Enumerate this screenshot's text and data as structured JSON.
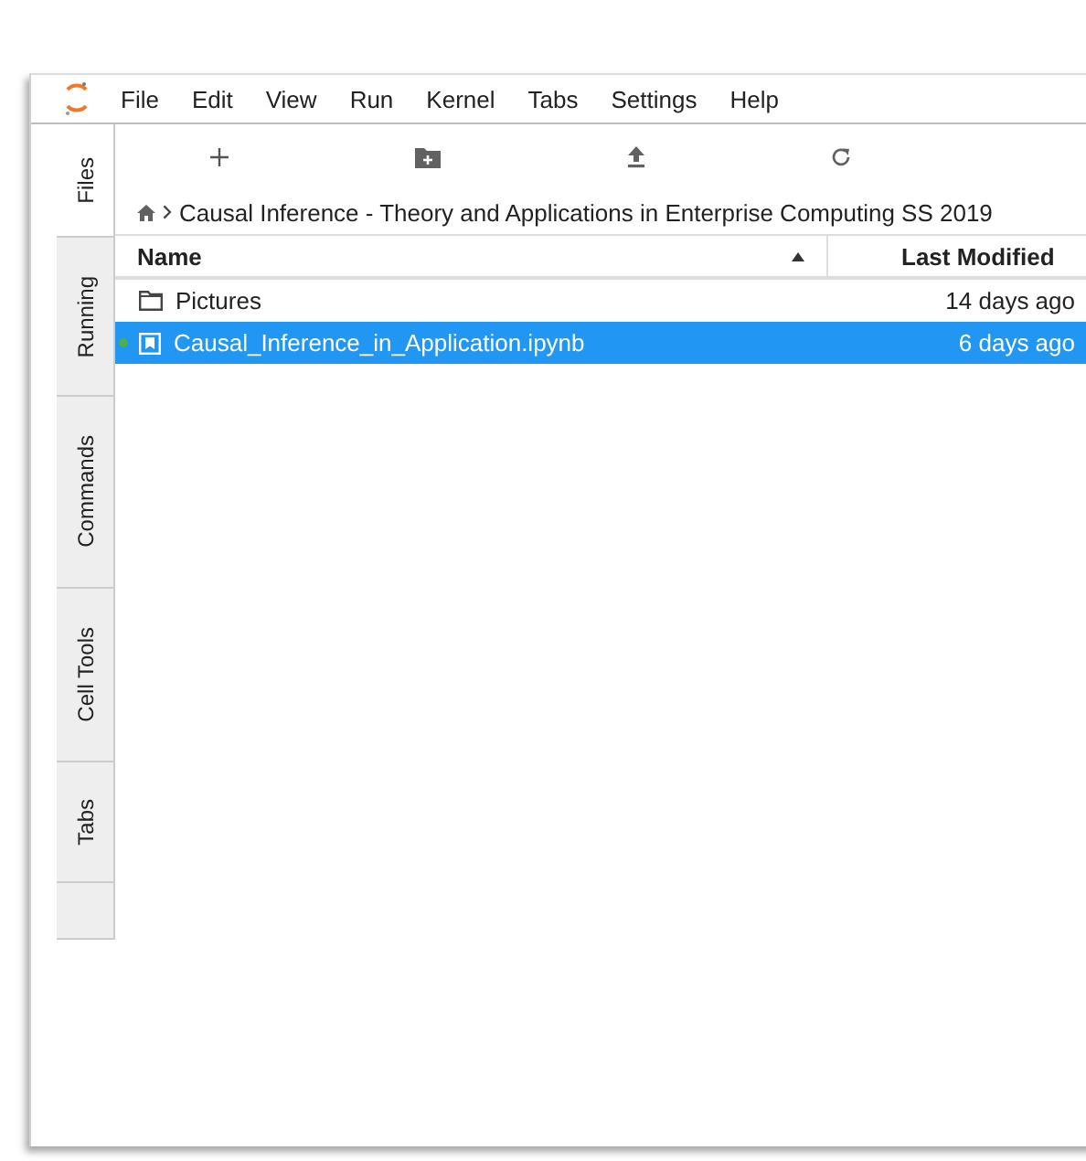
{
  "menu": [
    "File",
    "Edit",
    "View",
    "Run",
    "Kernel",
    "Tabs",
    "Settings",
    "Help"
  ],
  "side_tabs": [
    {
      "label": "Files",
      "selected": true
    },
    {
      "label": "Running",
      "selected": false
    },
    {
      "label": "Commands",
      "selected": false
    },
    {
      "label": "Cell Tools",
      "selected": false
    },
    {
      "label": "Tabs",
      "selected": false
    }
  ],
  "breadcrumb": "Causal Inference - Theory and Applications in Enterprise Computing SS 2019",
  "columns": {
    "name": "Name",
    "modified": "Last Modified"
  },
  "files": [
    {
      "kind": "folder",
      "name": "Pictures",
      "modified": "14 days ago",
      "selected": false,
      "running": false
    },
    {
      "kind": "notebook",
      "name": "Causal_Inference_in_Application.ipynb",
      "modified": "6 days ago",
      "selected": true,
      "running": true
    }
  ]
}
